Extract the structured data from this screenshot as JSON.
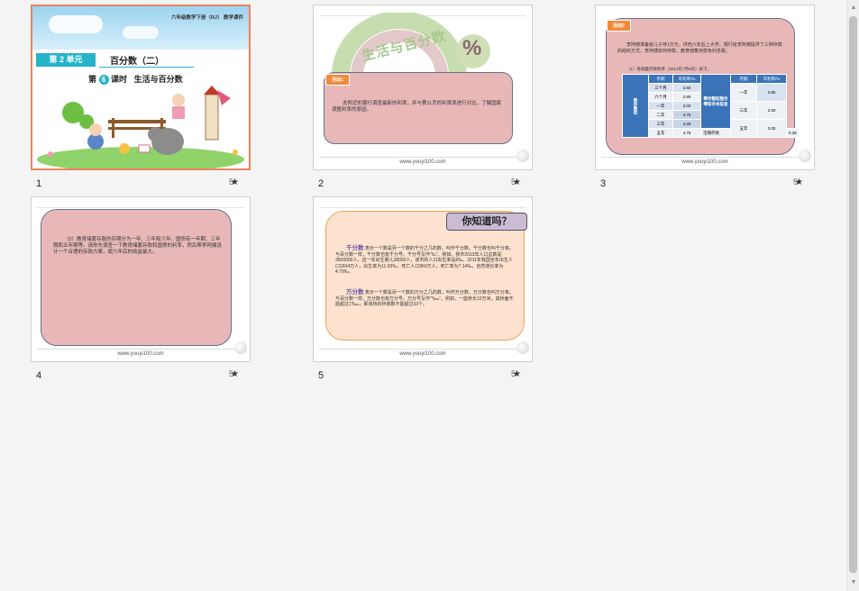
{
  "slides": [
    {
      "number": "1",
      "header_text": "六年级数学下册（RJ） 教学课件",
      "unit_label": "第 2 单元",
      "unit_title": "百分数（二）",
      "lesson_prefix": "第",
      "lesson_num": "6",
      "lesson_suffix": "课时",
      "lesson_title": "生活与百分数"
    },
    {
      "number": "2",
      "banner_text": "生活与百分数",
      "percent_sign": "%",
      "badge": "活动1",
      "body": "去附近的银行调查最新的利率，并与第11页的利率表进行对比，了解国家调整利率的原因。",
      "footer": "www.youyi100.com"
    },
    {
      "number": "3",
      "badge": "活动2",
      "body": "李阿姨准备给儿子存1万元，供他六年后上大学。银行给李阿姨提供了三种存款的组织方式，李阿姨如何存款，教育储蓄存款免利息税。",
      "table_caption": "（1）各储蓄存款利率（2012年7月6日）如下。",
      "left_header": "整存整取",
      "col_term": "存期",
      "col_rate": "年利率/%",
      "left_rows": [
        {
          "term": "三个月",
          "rate": "2.60"
        },
        {
          "term": "六个月",
          "rate": "2.80"
        },
        {
          "term": "一年",
          "rate": "3.00"
        },
        {
          "term": "二年",
          "rate": "3.75"
        },
        {
          "term": "三年",
          "rate": "4.25"
        },
        {
          "term": "五年",
          "rate": "4.75"
        }
      ],
      "mid_header": "零存整取整存零取存本取息",
      "right_rows": [
        {
          "term": "一年",
          "rate": "2.85"
        },
        {
          "term": "三年",
          "rate": "2.90"
        },
        {
          "term": "五年",
          "rate": "3.00"
        },
        {
          "term": "活期存款",
          "rate": "0.35"
        }
      ],
      "footer": "www.youyi100.com"
    },
    {
      "number": "4",
      "body": "（2）教育储蓄存款的存期分为一年、三年和六年。国债有一年期、三年期和五年期等。请你先调查一下教育储蓄存款和国债的利率，然后帮李阿姨设计一个合理的存款方案，使六年后的收益最大。",
      "footer": "www.youyi100.com"
    },
    {
      "number": "5",
      "title": "你知道吗？",
      "term1": "千分数",
      "body1": "表示一个数是另一个数的千分之几的数，叫作千分数。千分数也叫千分率。与百分数一样，千分数也有千分号。千分号写作“‰”。例如，我市2013年人口总数是3500000人，这一年出生婴儿28000人，该市的人口出生率是8‰。2011年我国全年出生人口1604万人，出生率为11.93‰，死亡人口960万人，死亡率为7.14‰，自然增长率为4.79‰。",
      "term2": "万分数",
      "body2": "表示一个数是另一个数的万分之几的数，叫作万分数，万分数也叫万分率。与百分数一样，万分数也有万分号。万分号写作“‱”。例如，一座桥长10万米，其桥面不能超过1‱，即该桥的桥墩数不能超过10个。",
      "footer": "www.youyi100.com"
    }
  ],
  "star_prefix": "5",
  "star_icon": "★",
  "colors": {
    "selected_border": "#f0825c",
    "pink_box": "#e8b8b8",
    "orange_badge": "#f08a3a",
    "table_blue": "#3a73b8",
    "peach_box": "#fde3cf"
  }
}
